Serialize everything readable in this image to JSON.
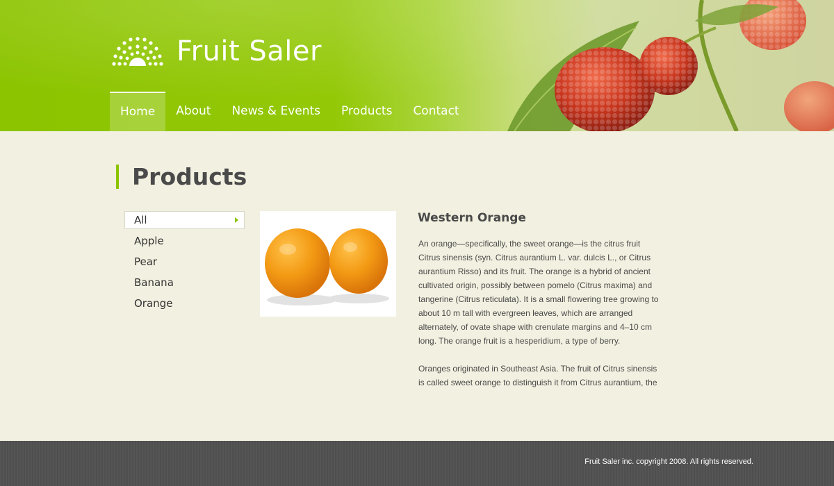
{
  "site": {
    "brand": "Fruit Saler"
  },
  "nav": {
    "items": [
      {
        "label": "Home",
        "active": true
      },
      {
        "label": "About"
      },
      {
        "label": "News & Events"
      },
      {
        "label": "Products"
      },
      {
        "label": "Contact"
      }
    ]
  },
  "main": {
    "title": "Products",
    "categories": [
      {
        "label": "All",
        "active": true
      },
      {
        "label": "Apple"
      },
      {
        "label": "Pear"
      },
      {
        "label": "Banana"
      },
      {
        "label": "Orange"
      }
    ],
    "product": {
      "name": "Western Orange",
      "paragraphs": [
        "An orange—specifically, the sweet orange—is the citrus fruit Citrus sinensis (syn. Citrus aurantium L. var. dulcis L., or Citrus aurantium Risso) and its fruit. The orange is a hybrid of ancient cultivated origin, possibly between pomelo (Citrus maxima) and tangerine (Citrus reticulata). It is a small flowering tree growing to about 10 m tall with evergreen leaves, which are arranged alternately, of ovate shape with crenulate margins and 4–10 cm long. The orange fruit is a hesperidium, a type of berry.",
        "Oranges originated in Southeast Asia. The fruit of Citrus sinensis is called sweet orange to distinguish it from Citrus aurantium, the"
      ]
    }
  },
  "footer": {
    "copyright": "Fruit Saler inc. copyright 2008. All rights reserved."
  },
  "colors": {
    "accent": "#8cc400",
    "background": "#f2f0e0",
    "footer": "#555555"
  },
  "icons": {
    "logo": "sun-rays-icon",
    "category_arrow": "triangle-right-icon"
  }
}
